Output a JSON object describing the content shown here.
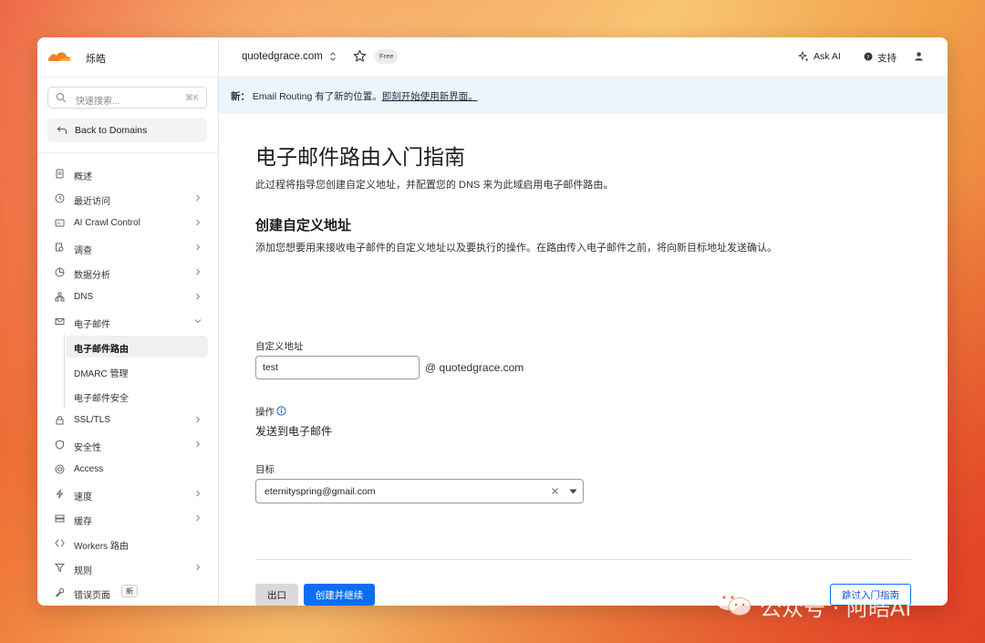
{
  "account": {
    "name": "烁皓"
  },
  "sidebar": {
    "search_placeholder": "快速搜索...",
    "search_shortcut": "⌘K",
    "back_label": "Back to Domains",
    "items": [
      {
        "label": "概述",
        "icon": "document-icon",
        "chevron": false
      },
      {
        "label": "最近访问",
        "icon": "clock-icon",
        "chevron": true
      },
      {
        "label": "AI Crawl Control",
        "icon": "ai-icon",
        "chevron": true
      },
      {
        "label": "调查",
        "icon": "investigate-icon",
        "chevron": true
      },
      {
        "label": "数据分析",
        "icon": "chart-icon",
        "chevron": true
      },
      {
        "label": "DNS",
        "icon": "network-icon",
        "chevron": true
      },
      {
        "label": "电子邮件",
        "icon": "mail-icon",
        "chevron": "down"
      },
      {
        "label": "电子邮件路由",
        "icon": "",
        "chevron": false,
        "sub": true,
        "active": true
      },
      {
        "label": "DMARC 管理",
        "icon": "",
        "chevron": false,
        "sub": true
      },
      {
        "label": "电子邮件安全",
        "icon": "",
        "chevron": false,
        "sub": true
      },
      {
        "label": "SSL/TLS",
        "icon": "lock-icon",
        "chevron": true
      },
      {
        "label": "安全性",
        "icon": "shield-icon",
        "chevron": true
      },
      {
        "label": "Access",
        "icon": "access-icon",
        "chevron": false
      },
      {
        "label": "速度",
        "icon": "bolt-icon",
        "chevron": true
      },
      {
        "label": "缓存",
        "icon": "cache-icon",
        "chevron": true
      },
      {
        "label": "Workers 路由",
        "icon": "workers-icon",
        "chevron": false
      },
      {
        "label": "规则",
        "icon": "rules-icon",
        "chevron": true
      },
      {
        "label": "错误页面",
        "icon": "wrench-icon",
        "chevron": false,
        "badge": "新"
      }
    ]
  },
  "topbar": {
    "domain": "quotedgrace.com",
    "plan_badge": "Free",
    "ask_ai": "Ask AI",
    "support": "支持"
  },
  "banner": {
    "prefix": "新：",
    "text": "Email Routing 有了新的位置。",
    "link": "即刻开始使用新界面。"
  },
  "main": {
    "title": "电子邮件路由入门指南",
    "description": "此过程将指导您创建自定义地址，并配置您的 DNS 来为此域启用电子邮件路由。",
    "section_title": "创建自定义地址",
    "section_description": "添加您想要用来接收电子邮件的自定义地址以及要执行的操作。在路由传入电子邮件之前，将向新目标地址发送确认。",
    "custom_address_label": "自定义地址",
    "custom_address_value": "test",
    "at_domain": "@  quotedgrace.com",
    "action_label": "操作",
    "action_value": "发送到电子邮件",
    "target_label": "目标",
    "target_value": "eternityspring@gmail.com",
    "exit_button": "出口",
    "create_button": "创建并继续",
    "skip_button": "跳过入门指南"
  },
  "watermark": {
    "text": "公众号 · 阿皓AI"
  },
  "colors": {
    "accent": "#0a6ef3",
    "brand_orange": "#f38020",
    "banner_bg": "#eef4fc"
  }
}
